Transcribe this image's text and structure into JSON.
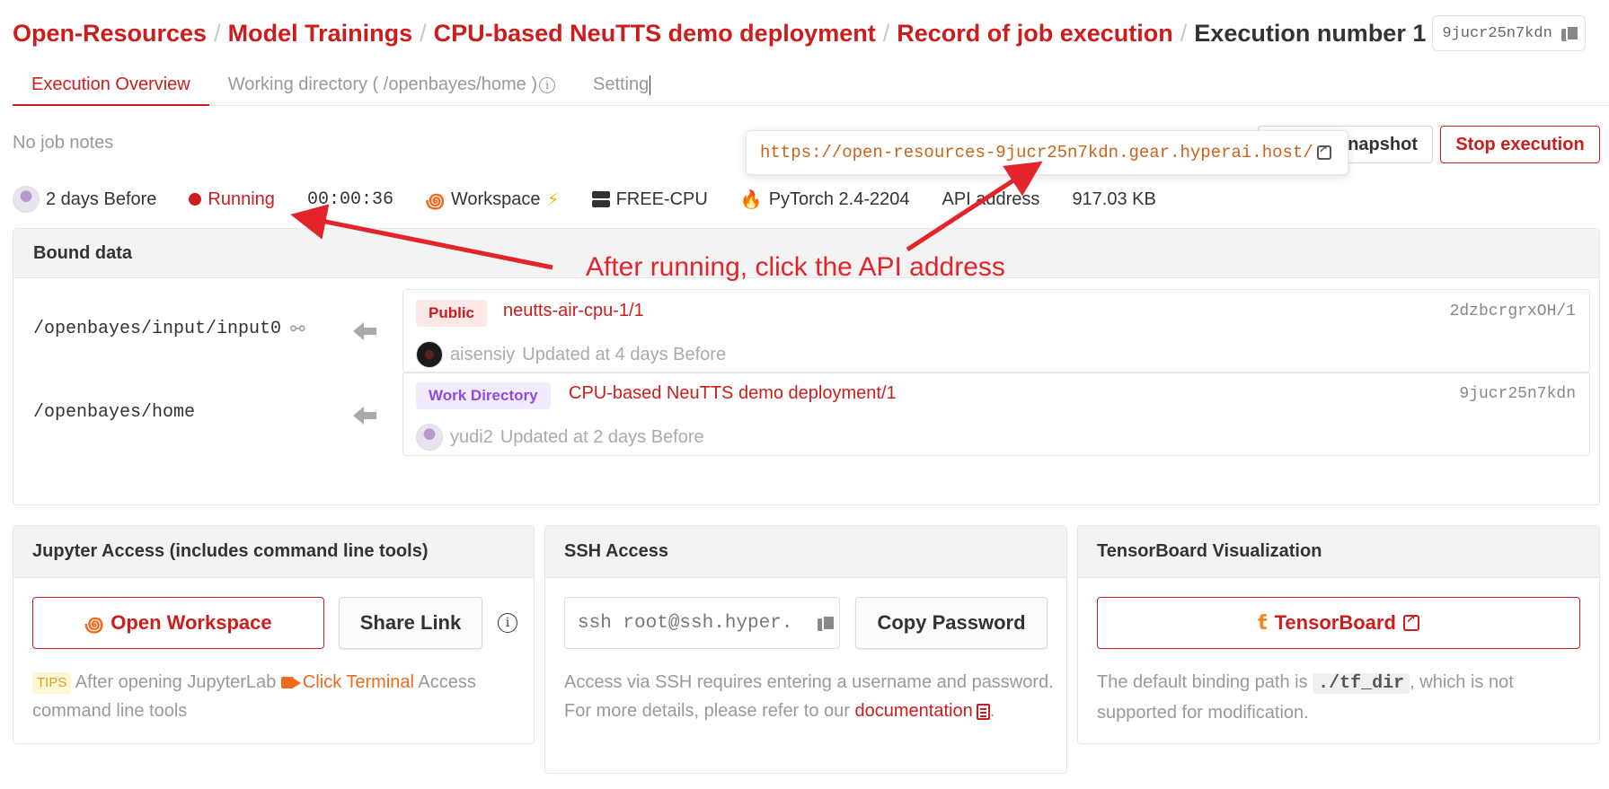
{
  "breadcrumb": {
    "items": [
      "Open-Resources",
      "Model Trainings",
      "CPU-based NeuTTS demo deployment",
      "Record of job execution"
    ],
    "separator": "/",
    "current": "Execution number 1",
    "id_chip": "9jucr25n7kdn"
  },
  "tabs": {
    "overview": "Execution Overview",
    "workdir": "Working directory ( /openbayes/home )",
    "setting": "Setting"
  },
  "notes": "No job notes",
  "actions": {
    "snapshot": "napshot",
    "stop": "Stop execution"
  },
  "api_tooltip": {
    "url": "https://open-resources-9jucr25n7kdn.gear.hyperai.host/"
  },
  "meta": {
    "created": "2 days Before",
    "status": "Running",
    "duration": "00:00:36",
    "workspace": "Workspace",
    "resource": "FREE-CPU",
    "image": "PyTorch 2.4-2204",
    "api": "API address",
    "size": "917.03 KB"
  },
  "bound_data": {
    "title": "Bound data",
    "rows": [
      {
        "path": "/openbayes/input/input0",
        "tag": "Public",
        "name": "neutts-air-cpu-1/1",
        "id": "2dzbcrgrxOH/1",
        "user": "aisensiy",
        "updated": "Updated at 4 days Before"
      },
      {
        "path": "/openbayes/home",
        "tag": "Work Directory",
        "name": "CPU-based NeuTTS demo deployment/1",
        "id": "9jucr25n7kdn",
        "user": "yudi2",
        "updated": "Updated at 2 days Before"
      }
    ]
  },
  "jupyter": {
    "title": "Jupyter Access (includes command line tools)",
    "open_btn": "Open Workspace",
    "share_btn": "Share Link",
    "tips_label": "TIPS",
    "tips_text_1": "After opening JupyterLab",
    "tips_link": "Click Terminal",
    "tips_text_2": "Access command line tools"
  },
  "ssh": {
    "title": "SSH Access",
    "command": "ssh root@ssh.hyper.",
    "copy_btn": "Copy Password",
    "desc": "Access via SSH requires entering a username and password. For more details, please refer to our",
    "doc_link": "documentation",
    "period": "."
  },
  "tensorboard": {
    "title": "TensorBoard Visualization",
    "btn": "TensorBoard",
    "desc_1": "The default binding path is",
    "path": "./tf_dir",
    "desc_2": ", which is not supported for modification."
  },
  "annotation": {
    "text": "After running, click the API address",
    "color": "#e3242b"
  },
  "colors": {
    "brand": "#cc1d1d",
    "accent_orange": "#f06a1c",
    "url": "#c8641a",
    "workdir_tag": "#8f4ae0"
  },
  "icons": {
    "copy": "copy-icon",
    "external": "external-link-icon",
    "unlink": "unlink-icon",
    "arrow": "arrow-left-icon",
    "workspace": "workspace-icon",
    "bolt": "lightning-icon",
    "server": "server-icon",
    "pytorch": "pytorch-icon",
    "info": "info-icon",
    "camera": "video-camera-icon",
    "document": "document-icon",
    "tensorboard": "tensorboard-icon"
  }
}
